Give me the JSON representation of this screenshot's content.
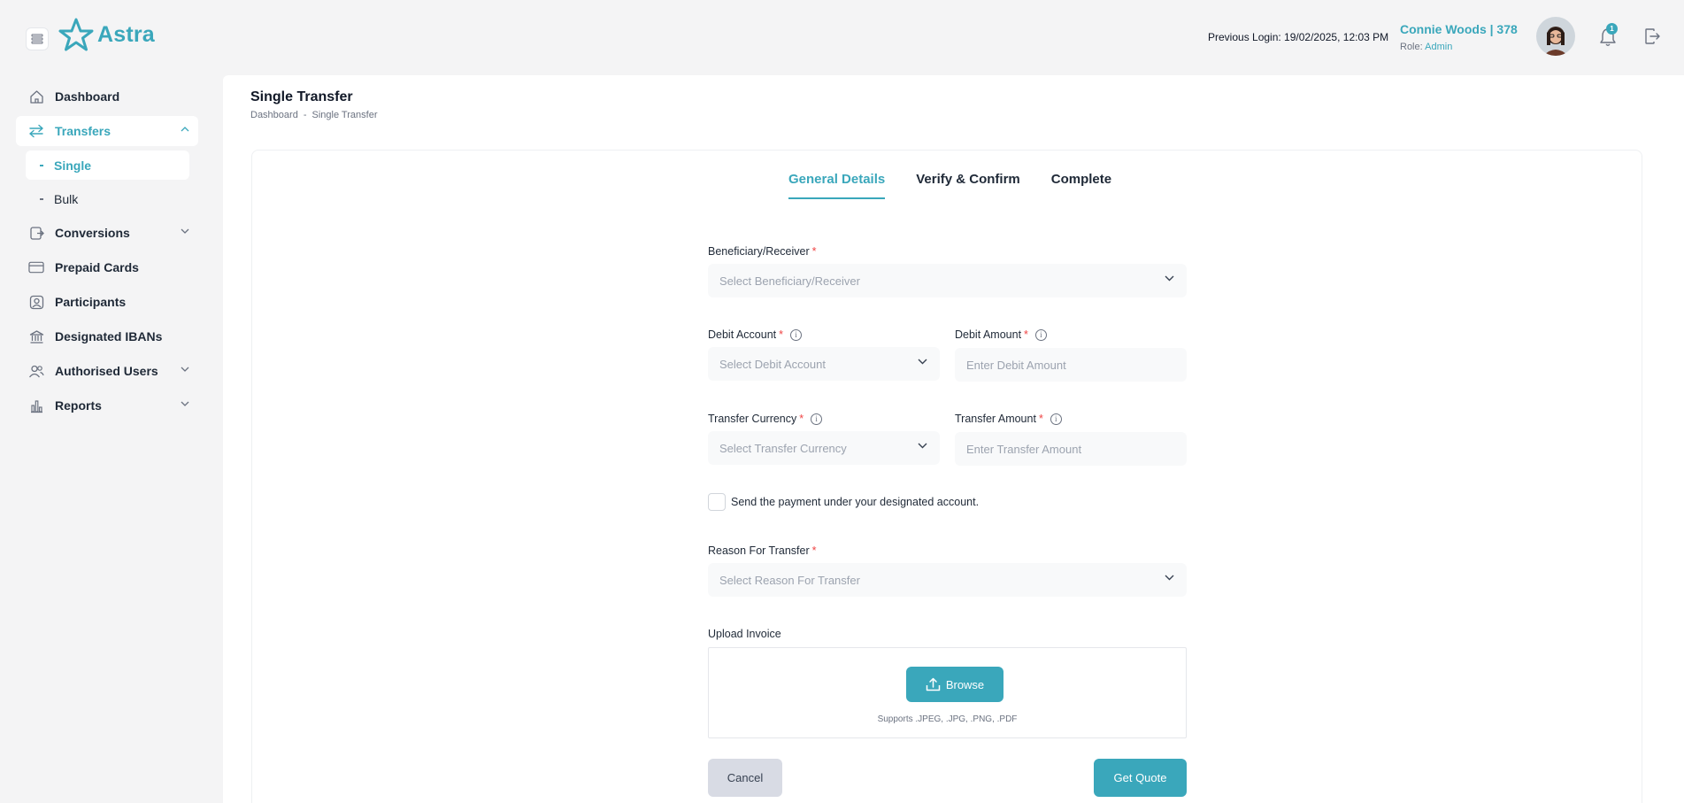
{
  "header": {
    "logo_text": "Astra",
    "previous_login": "Previous Login: 19/02/2025, 12:03 PM",
    "user_name": "Connie Woods | 378",
    "role_label": "Role: ",
    "role_value": "Admin",
    "notification_count": "1"
  },
  "sidebar": {
    "items": [
      {
        "label": "Dashboard",
        "icon": "home-icon"
      },
      {
        "label": "Transfers",
        "icon": "transfer-icon"
      },
      {
        "label": "Conversions",
        "icon": "conversion-icon"
      },
      {
        "label": "Prepaid Cards",
        "icon": "card-icon"
      },
      {
        "label": "Participants",
        "icon": "participant-icon"
      },
      {
        "label": "Designated IBANs",
        "icon": "bank-icon"
      },
      {
        "label": "Authorised Users",
        "icon": "users-icon"
      },
      {
        "label": "Reports",
        "icon": "reports-icon"
      }
    ],
    "transfers_sub": [
      {
        "label": "Single"
      },
      {
        "label": "Bulk"
      }
    ]
  },
  "page": {
    "title": "Single Transfer",
    "breadcrumb": [
      "Dashboard",
      "-",
      "Single Transfer"
    ]
  },
  "tabs": [
    {
      "label": "General Details"
    },
    {
      "label": "Verify & Confirm"
    },
    {
      "label": "Complete"
    }
  ],
  "form": {
    "beneficiary": {
      "label": "Beneficiary/Receiver",
      "placeholder": "Select Beneficiary/Receiver"
    },
    "debit_account": {
      "label": "Debit Account",
      "placeholder": "Select Debit Account"
    },
    "debit_amount": {
      "label": "Debit Amount",
      "placeholder": "Enter Debit Amount"
    },
    "transfer_currency": {
      "label": "Transfer Currency",
      "placeholder": "Select Transfer Currency"
    },
    "transfer_amount": {
      "label": "Transfer Amount",
      "placeholder": "Enter Transfer Amount"
    },
    "designated_checkbox": "Send the payment under your designated account.",
    "reason": {
      "label": "Reason For Transfer",
      "placeholder": "Select Reason For Transfer"
    },
    "upload": {
      "label": "Upload Invoice",
      "browse": "Browse",
      "supports": "Supports .JPEG, .JPG, .PNG, .PDF"
    },
    "required_mark": "*",
    "info_glyph": "i",
    "cancel": "Cancel",
    "get_quote": "Get Quote"
  },
  "colors": {
    "accent": "#3aa7bb",
    "background": "#f4f4f5"
  }
}
